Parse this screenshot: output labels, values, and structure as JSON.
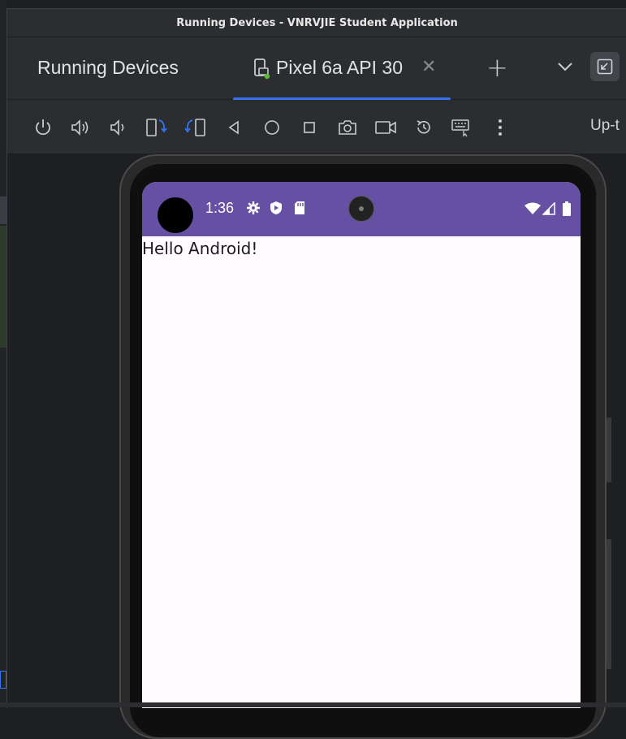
{
  "window": {
    "title": "Running Devices - VNRVJIE Student Application"
  },
  "tool_window": {
    "title": "Running Devices"
  },
  "device_tab": {
    "label": "Pixel 6a API 30"
  },
  "toolbar": {
    "trailing_text": "Up-t"
  },
  "status_bar": {
    "time": "1:36"
  },
  "app": {
    "greeting": "Hello Android!"
  },
  "colors": {
    "accent": "#3574f0",
    "status_bar": "#6650a4",
    "app_bg": "#fffbfe"
  },
  "icons": {
    "toolbar": [
      "power-icon",
      "volume-up-icon",
      "volume-down-icon",
      "rotate-left-icon",
      "rotate-right-icon",
      "back-icon",
      "home-icon",
      "overview-icon",
      "screenshot-icon",
      "screen-record-icon",
      "reset-icon",
      "keyboard-icon",
      "more-icon"
    ]
  }
}
